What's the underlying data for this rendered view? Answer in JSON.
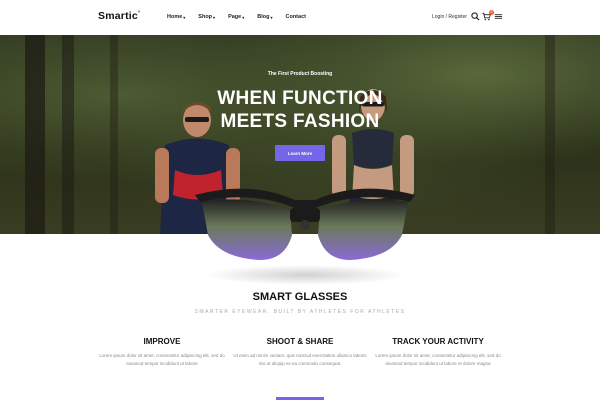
{
  "header": {
    "logo": "Smartic",
    "logo_mark": "°",
    "nav": [
      {
        "label": "Home",
        "has_caret": true
      },
      {
        "label": "Shop",
        "has_caret": true
      },
      {
        "label": "Page",
        "has_caret": true
      },
      {
        "label": "Blog",
        "has_caret": true
      },
      {
        "label": "Contact",
        "has_caret": false
      }
    ],
    "caret": "▾",
    "login": "Login / Register",
    "cart_count": "0"
  },
  "hero": {
    "subtitle": "The First Product Boosting",
    "title_line1": "WHEN FUNCTION",
    "title_line2": "MEETS FASHION",
    "cta": "Learn More"
  },
  "section": {
    "title": "SMART GLASSES",
    "subtitle": "SMARTER EYEWEAR. BUILT BY ATHLETES FOR ATHLETES"
  },
  "features": [
    {
      "title": "IMPROVE",
      "text": "Lorem ipsum dolor sit amet, consectetur adipisicing elit, sed do eiusmod tempor incididunt ut labore"
    },
    {
      "title": "SHOOT & SHARE",
      "text": "Ut enim ad minim veniam, quis nostrud exercitation ullamco laboris nisi ut aliquip ex ea commodo consequat."
    },
    {
      "title": "TRACK YOUR ACTIVITY",
      "text": "Lorem ipsum dolor sit amet, consectetur adipisicing elit, sed do eiusmod tempor incididunt ut labore et dolore magna"
    }
  ],
  "colors": {
    "accent": "#7466e8",
    "badge": "#f25c2e"
  }
}
